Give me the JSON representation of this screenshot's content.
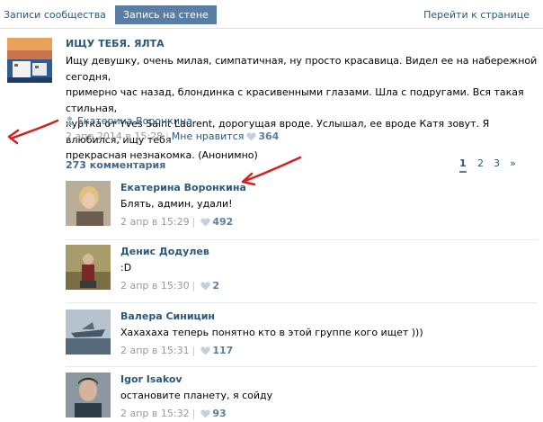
{
  "tabs": {
    "community_posts": "Записи сообщества",
    "wall_post": "Запись на стене",
    "go_to_page": "Перейти к странице"
  },
  "post": {
    "title": "ИЩУ ТЕБЯ. ЯЛТА",
    "text": "Ищу девушку, очень милая, симпатичная, ну просто красавица. Видел ее на набережной сегодня,\nпримерно час назад, блондинка с красивенными глазами. Шла с подругами. Вся такая стильная,\nкуртка от Yves Saint Laurent, дорогущая вроде. Услышал, ее вроде Катя зовут. Я влюбился, ищу тебя\nпрекрасная незнакомка. (Анонимно)",
    "signer": "Екатерина Воронкина",
    "date": "2 апр 2014 в 15:28",
    "separator": "|",
    "like_label": "Мне нравится",
    "likes": "364"
  },
  "comments": {
    "count_label": "273 комментария",
    "pages": [
      "1",
      "2",
      "3",
      "»"
    ]
  },
  "replies": [
    {
      "author": "Екатерина Воронкина",
      "text": "Блять, админ, удали!",
      "date": "2 апр в 15:29",
      "separator": "|",
      "likes": "492"
    },
    {
      "author": "Денис Додулев",
      "text": ":D",
      "date": "2 апр в 15:30",
      "separator": "|",
      "likes": "2"
    },
    {
      "author": "Валера Синицин",
      "text": "Хахахаха теперь понятно кто в этой группе кого ищет )))",
      "date": "2 апр в 15:31",
      "separator": "|",
      "likes": "117"
    },
    {
      "author": "Igor Isakov",
      "text": "остановите планету, я сойду",
      "date": "2 апр в 15:32",
      "separator": "|",
      "likes": "93"
    }
  ],
  "colors": {
    "link": "#2b587a",
    "active_tab": "#597da3",
    "meta_gray": "#999999",
    "annotation_red": "#d42020"
  },
  "icons": {
    "signer": "user-icon",
    "like": "heart-icon",
    "annotation": "red-arrow"
  }
}
